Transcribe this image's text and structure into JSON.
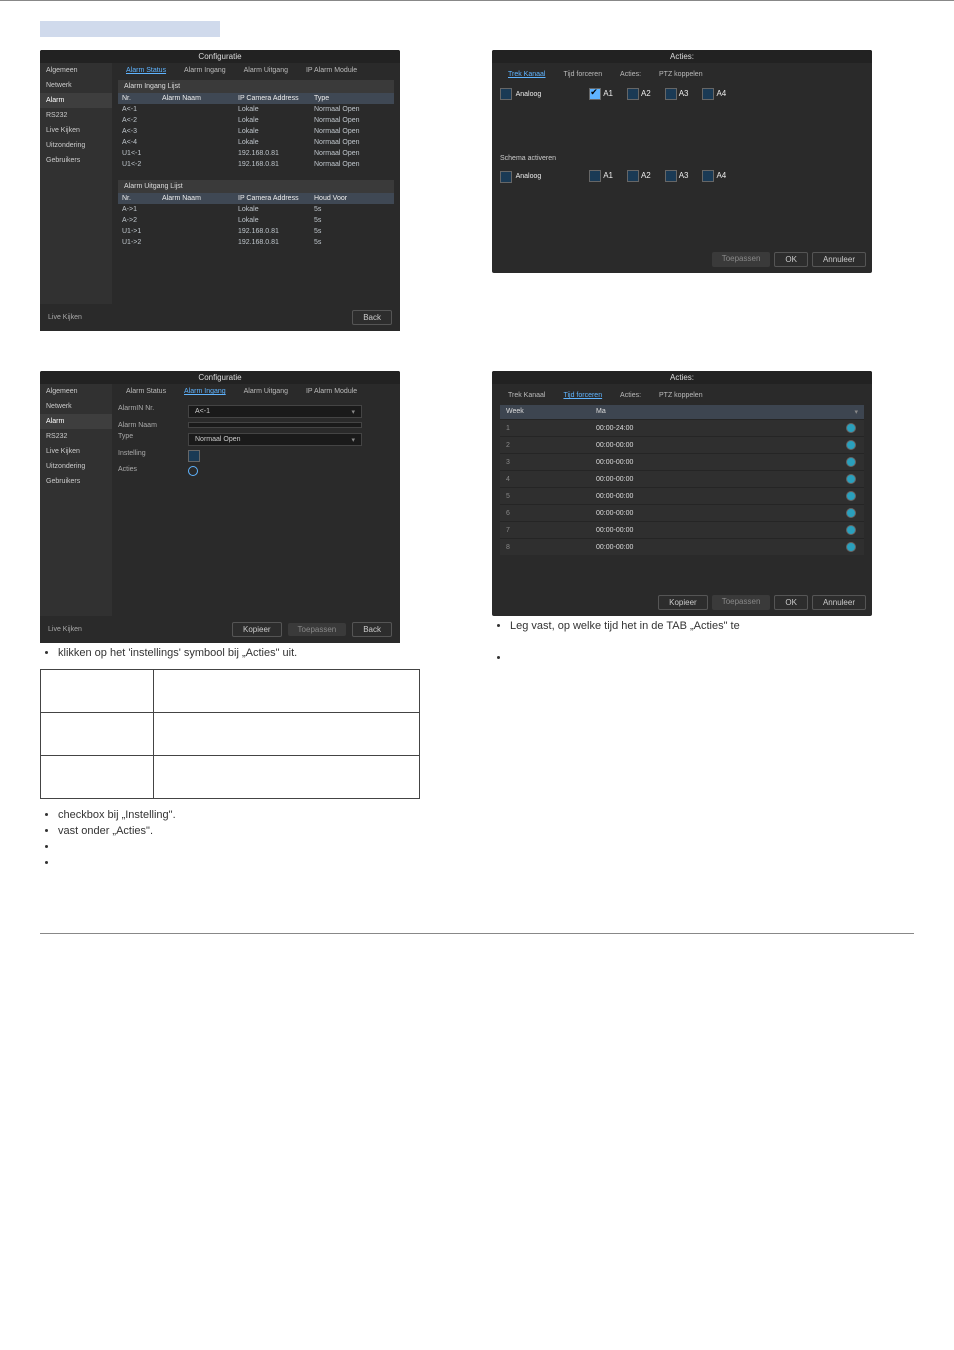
{
  "panel1": {
    "title": "Configuratie",
    "sidebar": [
      "Algemeen",
      "Netwerk",
      "Alarm",
      "RS232",
      "Live Kijken",
      "Uitzondering",
      "Gebruikers"
    ],
    "sidebar_active": 2,
    "tabs": [
      "Alarm Status",
      "Alarm Ingang",
      "Alarm Uitgang",
      "IP Alarm Module"
    ],
    "tab_active": 0,
    "sub1": "Alarm Ingang Lijst",
    "head1": [
      "Nr.",
      "Alarm Naam",
      "IP Camera Address",
      "Type"
    ],
    "rows1": [
      [
        "A<-1",
        "",
        "Lokale",
        "Normaal Open"
      ],
      [
        "A<-2",
        "",
        "Lokale",
        "Normaal Open"
      ],
      [
        "A<-3",
        "",
        "Lokale",
        "Normaal Open"
      ],
      [
        "A<-4",
        "",
        "Lokale",
        "Normaal Open"
      ],
      [
        "U1<-1",
        "",
        "192.168.0.81",
        "Normaal Open"
      ],
      [
        "U1<-2",
        "",
        "192.168.0.81",
        "Normaal Open"
      ]
    ],
    "sub2": "Alarm Uitgang Lijst",
    "head2": [
      "Nr.",
      "Alarm Naam",
      "IP Camera Address",
      "Houd Voor"
    ],
    "rows2": [
      [
        "A->1",
        "",
        "Lokale",
        "5s"
      ],
      [
        "A->2",
        "",
        "Lokale",
        "5s"
      ],
      [
        "U1->1",
        "",
        "192.168.0.81",
        "5s"
      ],
      [
        "U1->2",
        "",
        "192.168.0.81",
        "5s"
      ]
    ],
    "footer_left": "Live Kijken",
    "back": "Back"
  },
  "panel2": {
    "title": "Acties:",
    "tabs": [
      "Trek Kanaal",
      "Tijd forceren",
      "Acties:",
      "PTZ koppelen"
    ],
    "tab_active": 0,
    "label_analoog": "Analoog",
    "a_items": [
      "A1",
      "A2",
      "A3",
      "A4"
    ],
    "checked": [
      0
    ],
    "schema": "Schema activeren",
    "buttons": {
      "toepassen": "Toepassen",
      "ok": "OK",
      "annuleer": "Annuleer"
    }
  },
  "panel3": {
    "title": "Configuratie",
    "sidebar": [
      "Algemeen",
      "Netwerk",
      "Alarm",
      "RS232",
      "Live Kijken",
      "Uitzondering",
      "Gebruikers"
    ],
    "sidebar_active": 2,
    "tabs": [
      "Alarm Status",
      "Alarm Ingang",
      "Alarm Uitgang",
      "IP Alarm Module"
    ],
    "tab_active": 1,
    "rows": [
      {
        "label": "AlarmIN Nr.",
        "val": "A<-1",
        "dd": true
      },
      {
        "label": "Alarm Naam",
        "val": "",
        "dd": false
      },
      {
        "label": "Type",
        "val": "Normaal Open",
        "dd": true
      },
      {
        "label": "Instelling",
        "cb": true
      },
      {
        "label": "Acties",
        "gear": true
      }
    ],
    "footer_left": "Live Kijken",
    "kopieer": "Kopieer",
    "toepassen": "Toepassen",
    "back": "Back"
  },
  "panel4": {
    "title": "Acties:",
    "tabs": [
      "Trek Kanaal",
      "Tijd forceren",
      "Acties:",
      "PTZ koppelen"
    ],
    "tab_active": 1,
    "week_label": "Week",
    "week_val": "Ma",
    "rows": [
      {
        "n": "1",
        "t": "00:00-24:00"
      },
      {
        "n": "2",
        "t": "00:00-00:00"
      },
      {
        "n": "3",
        "t": "00:00-00:00"
      },
      {
        "n": "4",
        "t": "00:00-00:00"
      },
      {
        "n": "5",
        "t": "00:00-00:00"
      },
      {
        "n": "6",
        "t": "00:00-00:00"
      },
      {
        "n": "7",
        "t": "00:00-00:00"
      },
      {
        "n": "8",
        "t": "00:00-00:00"
      }
    ],
    "buttons": {
      "kopieer": "Kopieer",
      "toepassen": "Toepassen",
      "ok": "OK",
      "annuleer": "Annuleer"
    }
  },
  "bullets_left": [
    "klikken op het 'instellings' symbool bij „Acties\" uit.",
    "checkbox bij „Instelling\".",
    "vast onder „Acties\"."
  ],
  "bullets_right": [
    "Leg vast, op welke tijd het in de TAB „Acties\" te"
  ]
}
